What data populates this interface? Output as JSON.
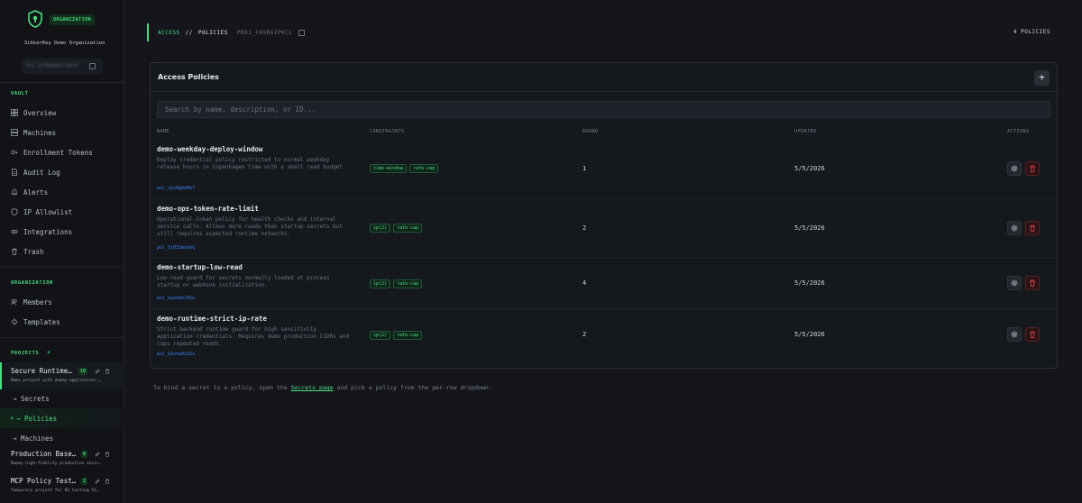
{
  "org": {
    "badge": "ORGANIZATION",
    "name": "SikkerKey Demo Organization",
    "id_masked": "0rg_1xY9mndpQr7abcd"
  },
  "sidebar": {
    "vault_label": "VAULT",
    "vault_items": [
      {
        "label": "Overview",
        "icon": "grid-icon"
      },
      {
        "label": "Machines",
        "icon": "server-icon"
      },
      {
        "label": "Enrollment Tokens",
        "icon": "key-icon"
      },
      {
        "label": "Audit Log",
        "icon": "file-icon"
      },
      {
        "label": "Alerts",
        "icon": "bell-icon"
      },
      {
        "label": "IP Allowlist",
        "icon": "shield-icon"
      },
      {
        "label": "Integrations",
        "icon": "link-icon"
      },
      {
        "label": "Trash",
        "icon": "trash-icon"
      }
    ],
    "org_label": "ORGANIZATION",
    "org_items": [
      {
        "label": "Members",
        "icon": "users-icon"
      },
      {
        "label": "Templates",
        "icon": "template-icon"
      }
    ],
    "projects_label": "PROJECTS",
    "projects_add": "+",
    "projects": [
      {
        "title": "Secure Runtime…",
        "count": "10",
        "desc": "Demo project with dummy application …"
      },
      {
        "title": "Production Base…",
        "count": "8",
        "desc": "Dummy high-fidelity production envir…"
      },
      {
        "title": "MCP Policy Test…",
        "count": "2",
        "desc": "Temporary project for OS testing SI…"
      }
    ],
    "sub_items": [
      "→ Secrets",
      "→ Policies",
      "→ Machines"
    ]
  },
  "breadcrumb": {
    "part1": "ACCESS",
    "sep": "//",
    "part2": "POLICIES",
    "project_id": "PROJ_CH9R6ZPKCL"
  },
  "policy_count": "4 POLICIES",
  "panel": {
    "title": "Access Policies",
    "add_label": "+",
    "search_placeholder": "Search by name, description, or ID...",
    "columns": {
      "name": "NAME",
      "constraints": "CONSTRAINTS",
      "bound": "BOUND",
      "updated": "UPDATED",
      "actions": "ACTIONS"
    }
  },
  "policies": [
    {
      "name": "demo-weekday-deploy-window",
      "desc": "Deploy credential policy restricted to normal weekday release hours in Copenhagen time with a small read budget",
      "id": "pol_u1v8gbd9b7",
      "tags": [
        "time-window",
        "rate-cap"
      ],
      "bound": "1",
      "updated": "5/5/2026"
    },
    {
      "name": "demo-ops-token-rate-limit",
      "desc": "Operational-token policy for health checks and internal service calls. Allows more reads than startup secrets but still requires expected runtime networks.",
      "id": "pol_5j832masbq",
      "tags": [
        "ip(2)",
        "rate-cap"
      ],
      "bound": "2",
      "updated": "5/5/2026"
    },
    {
      "name": "demo-startup-low-read",
      "desc": "Low-read guard for secrets normally loaded at process startup or webhook initialization.",
      "id": "pol_nue4dzl01u",
      "tags": [
        "ip(2)",
        "rate-cap"
      ],
      "bound": "4",
      "updated": "5/5/2026"
    },
    {
      "name": "demo-runtime-strict-ip-rate",
      "desc": "Strict backend runtime guard for high sensitivity application credentials. Requires demo production CIDRs and caps repeated reads.",
      "id": "pol_b2nnw0u32x",
      "tags": [
        "ip(2)",
        "rate-cap"
      ],
      "bound": "2",
      "updated": "5/5/2026"
    }
  ],
  "footer": {
    "before": "To bind a secret to a policy, open the",
    "link": "Secrets page",
    "after": "and pick a policy from the per-row dropdown."
  },
  "colors": {
    "accent": "#4ade80",
    "danger": "#ef4444",
    "link": "#3b82f6"
  }
}
